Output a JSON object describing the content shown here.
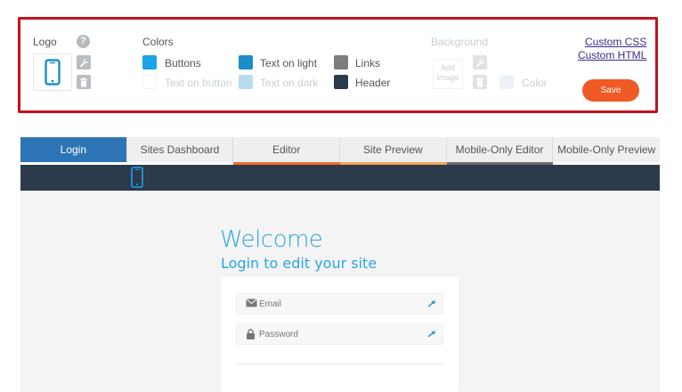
{
  "settings": {
    "logo_label": "Logo",
    "help_glyph": "?",
    "colors_label": "Colors",
    "swatches": [
      {
        "label": "Buttons",
        "color": "#1aa3e8",
        "muted": false
      },
      {
        "label": "Text on button",
        "color": "#ffffff",
        "muted": true
      },
      {
        "label": "Text on light",
        "color": "#1b8ec9",
        "muted": false
      },
      {
        "label": "Text on dark",
        "color": "#b7dcef",
        "muted": true
      },
      {
        "label": "Links",
        "color": "#7d7d7d",
        "muted": false
      },
      {
        "label": "Header",
        "color": "#2b3a4b",
        "muted": false
      }
    ],
    "background_label": "Background",
    "add_image_label": "Add Image",
    "bg_color_label": "Color",
    "custom_css": "Custom CSS",
    "custom_html": "Custom HTML",
    "save_label": "Save"
  },
  "tabs": [
    {
      "label": "Login",
      "active": true,
      "underline": ""
    },
    {
      "label": "Sites Dashboard",
      "active": false,
      "underline": ""
    },
    {
      "label": "Editor",
      "active": false,
      "underline": "#f26a2b"
    },
    {
      "label": "Site Preview",
      "active": false,
      "underline": "#f5a35b"
    },
    {
      "label": "Mobile-Only Editor",
      "active": false,
      "underline": "#6b6b6b"
    },
    {
      "label": "Mobile-Only Preview",
      "active": false,
      "underline": ""
    }
  ],
  "login": {
    "title": "Welcome",
    "subtitle": "Login to edit your site",
    "email_placeholder": "Email",
    "password_placeholder": "Password"
  },
  "colors": {
    "accent": "#2ba6e1",
    "save": "#f05a24",
    "header": "#2b3a4b",
    "active_tab": "#2e75b6"
  }
}
